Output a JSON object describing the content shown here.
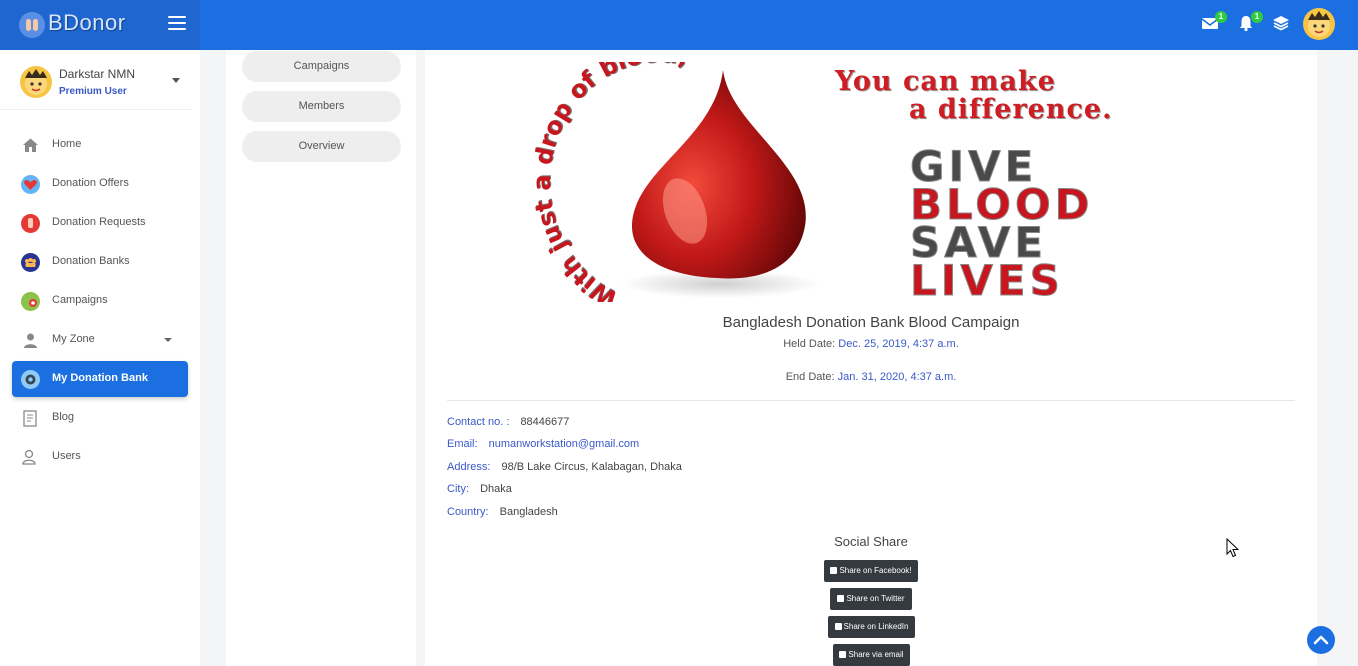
{
  "brand": {
    "name": "BDonor"
  },
  "header": {
    "icons": [
      "mail-icon",
      "bell-icon",
      "layers-icon"
    ],
    "mail_badge": "1",
    "bell_badge": "1"
  },
  "user": {
    "name": "Darkstar NMN",
    "role": "Premium User"
  },
  "sidebar": {
    "items": [
      {
        "label": "Home",
        "icon": "home-icon"
      },
      {
        "label": "Donation Offers",
        "icon": "heart-icon"
      },
      {
        "label": "Donation Requests",
        "icon": "hand-icon"
      },
      {
        "label": "Donation Banks",
        "icon": "people-icon"
      },
      {
        "label": "Campaigns",
        "icon": "campaign-icon"
      },
      {
        "label": "My Zone",
        "icon": "user-icon"
      },
      {
        "label": "My Donation Bank",
        "icon": "bank-icon"
      },
      {
        "label": "Blog",
        "icon": "blog-icon"
      },
      {
        "label": "Users",
        "icon": "users-icon"
      }
    ]
  },
  "tabs": {
    "campaigns": "Campaigns",
    "members": "Members",
    "overview": "Overview"
  },
  "banner": {
    "arc_text": "With just a drop of blood,",
    "slogan_line1": "You can make",
    "slogan_line2": "a difference.",
    "give": "GIVE",
    "blood": "BLOOD",
    "save": "SAVE",
    "lives": "LIVES"
  },
  "campaign": {
    "title": "Bangladesh Donation Bank Blood Campaign",
    "held_label": "Held Date:",
    "held_value": "Dec. 25, 2019, 4:37 a.m.",
    "end_label": "End Date:",
    "end_value": "Jan. 31, 2020, 4:37 a.m."
  },
  "contact": {
    "contact_label": "Contact no. :",
    "contact_value": "88446677",
    "email_label": "Email:",
    "email_value": "numanworkstation@gmail.com",
    "address_label": "Address:",
    "address_value": "98/B Lake Circus, Kalabagan, Dhaka",
    "city_label": "City:",
    "city_value": "Dhaka",
    "country_label": "Country:",
    "country_value": "Bangladesh"
  },
  "social": {
    "title": "Social Share",
    "facebook": "Share on Facebook!",
    "twitter": "Share on Twitter",
    "linkedin": "Share on LinkedIn",
    "email": "Share via email"
  },
  "colors": {
    "primary": "#1b6fe0",
    "link": "#3a59c7",
    "blood": "#c8161f"
  }
}
